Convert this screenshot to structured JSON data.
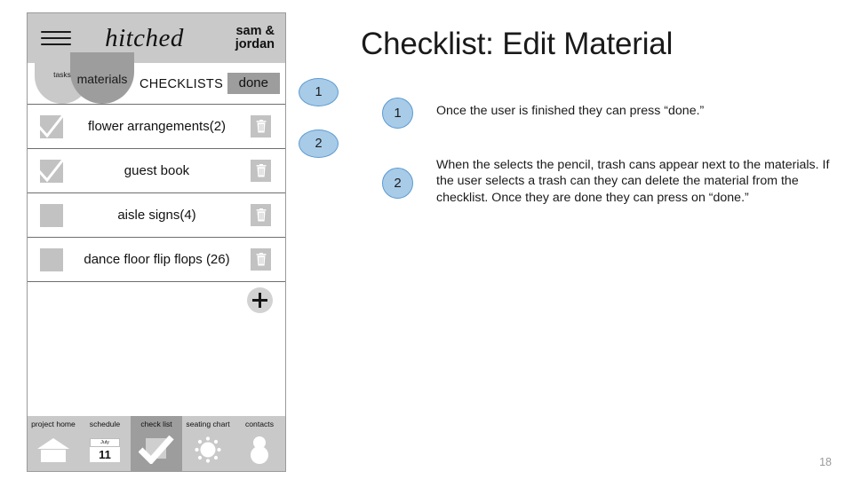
{
  "slide": {
    "title": "Checklist: Edit Material",
    "page_number": "18"
  },
  "phone": {
    "header": {
      "menu_icon": "hamburger-icon",
      "brand": "hitched",
      "account": "sam & jordan"
    },
    "tabs": [
      {
        "label": "tasks",
        "selected": false
      },
      {
        "label": "materials",
        "selected": true
      }
    ],
    "section_label": "CHECKLISTS",
    "done_button": "done",
    "checklist": [
      {
        "label": "flower arrangements(2)",
        "checked": true,
        "delete_icon": "trash-icon"
      },
      {
        "label": "guest book",
        "checked": true,
        "delete_icon": "trash-icon"
      },
      {
        "label": "aisle signs(4)",
        "checked": false,
        "delete_icon": "trash-icon"
      },
      {
        "label": "dance floor flip flops (26)",
        "checked": false,
        "delete_icon": "trash-icon"
      }
    ],
    "add_button": "add-icon",
    "bottom_nav": [
      {
        "label": "project home",
        "icon": "house-icon",
        "active": false
      },
      {
        "label": "schedule",
        "icon": "calendar-icon",
        "active": false,
        "month": "July",
        "day": "11"
      },
      {
        "label": "check list",
        "icon": "checkmark-icon",
        "active": true
      },
      {
        "label": "seating chart",
        "icon": "seating-chart-icon",
        "active": false
      },
      {
        "label": "contacts",
        "icon": "person-icon",
        "active": false
      }
    ]
  },
  "annotations": [
    {
      "number": "1",
      "text": "Once the user is finished they can press “done.”"
    },
    {
      "number": "2",
      "text": "When the selects the pencil, trash cans appear next to the materials. If the user selects a trash can they can delete the material from the checklist. Once they are done they can press on “done.”"
    }
  ],
  "callouts": [
    {
      "number": "1"
    },
    {
      "number": "2"
    }
  ],
  "colors": {
    "badge_fill": "#a8cbe8",
    "badge_stroke": "#5b9bd1",
    "chrome_gray": "#c9c9c9",
    "accent_gray": "#9d9d9d"
  }
}
